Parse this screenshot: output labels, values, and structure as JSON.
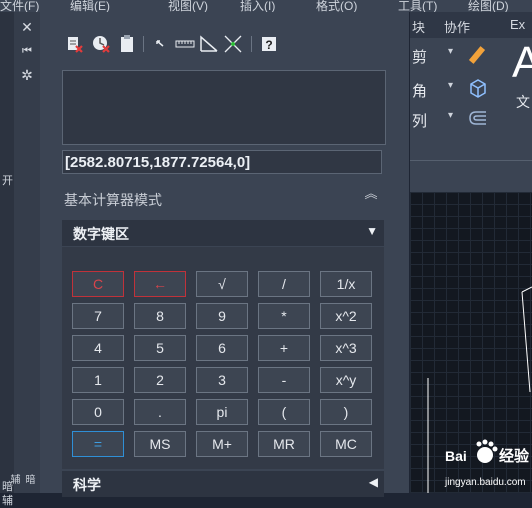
{
  "background_app": {
    "menubar": [
      "文件(F)",
      "编辑(E)",
      "视图(V)",
      "插入(I)",
      "格式(O)",
      "工具(T)",
      "绘图(D)"
    ],
    "ribbon_tabs": [
      "块",
      "协作",
      "Ex"
    ],
    "ribbon_items": [
      "剪",
      "角",
      "列",
      "A",
      "文"
    ],
    "left_labels": [
      "开",
      "暗",
      "辅"
    ]
  },
  "quickcalc": {
    "strip": {
      "close_glyph": "✕",
      "collapse_glyph": "⏮",
      "settings_glyph": "✲",
      "side_label": "暗辅"
    },
    "toolbar": {
      "items": [
        "clear-icon",
        "clear-history-icon",
        "paste-icon",
        "get-coordinates-icon",
        "distance-icon",
        "angle-icon",
        "intersection-icon",
        "help-icon"
      ],
      "help_glyph": "?"
    },
    "display_history": "",
    "input_value": "[2582.80715,1877.72564,0]",
    "mode_title": "基本计算器模式",
    "collapse_glyph": "︽",
    "number_pad": {
      "title": "数字键区",
      "arrow": "▼",
      "keys": [
        [
          "C",
          "←",
          "√",
          "/",
          "1/x"
        ],
        [
          "7",
          "8",
          "9",
          "*",
          "x^2"
        ],
        [
          "4",
          "5",
          "6",
          "+",
          "x^3"
        ],
        [
          "1",
          "2",
          "3",
          "-",
          "x^y"
        ],
        [
          "0",
          ".",
          "pi",
          "(",
          ")"
        ],
        [
          "=",
          "MS",
          "M+",
          "MR",
          "MC"
        ]
      ]
    },
    "scientific": {
      "title": "科学",
      "arrow": "◀"
    }
  },
  "colors": {
    "accent_red": "#d8444b",
    "accent_blue": "#3e9ee2",
    "annotation_red": "#e8231c"
  },
  "watermark": {
    "brand": "Bai",
    "text": "经验",
    "url": "jingyan.baidu.com"
  }
}
